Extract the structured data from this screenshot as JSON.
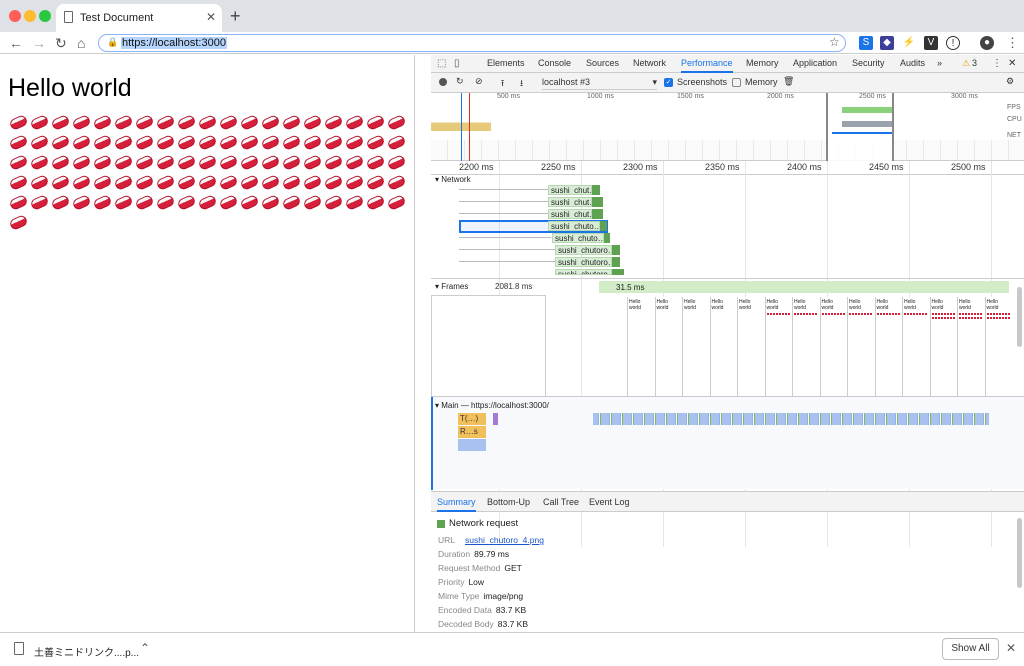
{
  "browser": {
    "tab_title": "Test Document",
    "url": "https://localhost:3000",
    "ext_badge": "⚠3"
  },
  "page": {
    "heading": "Hello world",
    "sushi_count": 96
  },
  "devtools": {
    "tabs": [
      "Elements",
      "Console",
      "Sources",
      "Network",
      "Performance",
      "Memory",
      "Application",
      "Security",
      "Audits"
    ],
    "active_tab": "Performance",
    "warning_count": "3",
    "profile_select": "localhost #3",
    "screenshots_label": "Screenshots",
    "screenshots_checked": true,
    "memory_label": "Memory",
    "memory_checked": false,
    "overview_ticks": [
      "500 ms",
      "1000 ms",
      "1500 ms",
      "2000 ms",
      "2500 ms",
      "3000 ms"
    ],
    "overview_labels": [
      "FPS",
      "CPU",
      "NET"
    ],
    "ruler_ticks": [
      "2200 ms",
      "2250 ms",
      "2300 ms",
      "2350 ms",
      "2400 ms",
      "2450 ms",
      "2500 ms"
    ],
    "network_label": "Network",
    "requests": [
      "sushi_chut…",
      "sushi_chut…",
      "sushi_chut…",
      "sushi_chuto…",
      "sushi_chuto…",
      "sushi_chutoro…",
      "sushi_chutoro…",
      "sushi_chutoro…"
    ],
    "frames_label": "Frames",
    "frame_time_1": "2081.8 ms",
    "frame_time_2": "31.5 ms",
    "frame_label": "Hello world",
    "main_label": "Main — https://localhost:3000/",
    "task_1": "T(…)",
    "task_2": "R…s",
    "bottom_tabs": [
      "Summary",
      "Bottom-Up",
      "Call Tree",
      "Event Log"
    ],
    "summary": {
      "title": "Network request",
      "url_label": "URL",
      "url_value": "sushi_chutoro_4.png",
      "duration_label": "Duration",
      "duration_value": "89.79 ms",
      "method_label": "Request Method",
      "method_value": "GET",
      "priority_label": "Priority",
      "priority_value": "Low",
      "mime_label": "Mime Type",
      "mime_value": "image/png",
      "encoded_label": "Encoded Data",
      "encoded_value": "83.7 KB",
      "decoded_label": "Decoded Body",
      "decoded_value": "83.7 KB"
    }
  },
  "download": {
    "filename": "土善ミニドリンク....p...",
    "show_all": "Show All"
  },
  "colors": {
    "accent": "#1a73e8",
    "request_green": "#5fa352",
    "sushi_red": "#d61f3b"
  }
}
